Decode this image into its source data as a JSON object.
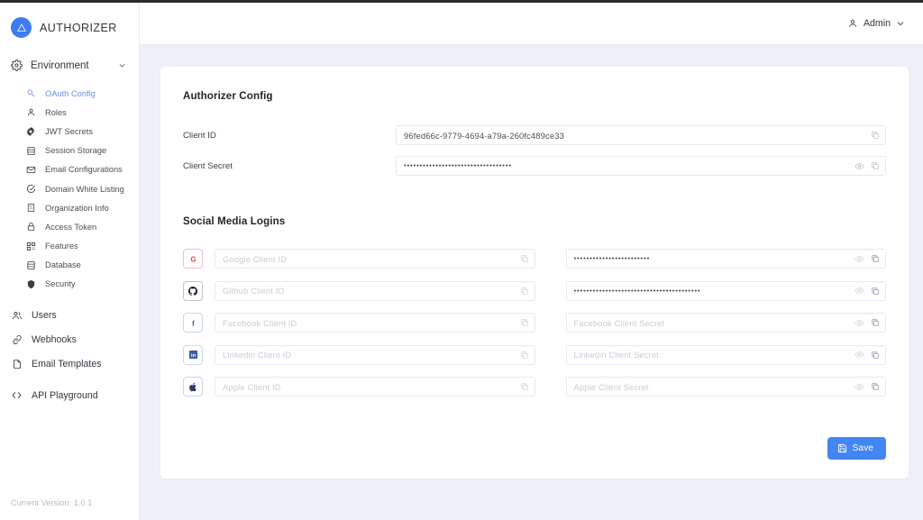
{
  "brand": {
    "name": "AUTHORIZER",
    "logo_icon": "triangle-logo-icon",
    "logo_color": "#3e7bf2"
  },
  "header": {
    "user_label": "Admin",
    "user_icon": "person-icon",
    "chevron_icon": "chevron-down-icon"
  },
  "sidebar": {
    "environment": {
      "label": "Environment",
      "icon": "gear-icon",
      "chevron": "chevron-down-icon"
    },
    "sub_items": [
      {
        "label": "OAuth Config",
        "icon": "key-icon",
        "active": true
      },
      {
        "label": "Roles",
        "icon": "person-icon",
        "active": false
      },
      {
        "label": "JWT Secrets",
        "icon": "cog-icon",
        "active": false
      },
      {
        "label": "Session Storage",
        "icon": "database-icon",
        "active": false
      },
      {
        "label": "Email Configurations",
        "icon": "mail-icon",
        "active": false
      },
      {
        "label": "Domain White Listing",
        "icon": "check-circle-icon",
        "active": false
      },
      {
        "label": "Organization Info",
        "icon": "building-icon",
        "active": false
      },
      {
        "label": "Access Token",
        "icon": "lock-icon",
        "active": false
      },
      {
        "label": "Features",
        "icon": "grid-icon",
        "active": false
      },
      {
        "label": "Database",
        "icon": "database-icon",
        "active": false
      },
      {
        "label": "Security",
        "icon": "shield-icon",
        "active": false
      }
    ],
    "main_items": [
      {
        "label": "Users",
        "icon": "users-icon"
      },
      {
        "label": "Webhooks",
        "icon": "link-icon"
      },
      {
        "label": "Email Templates",
        "icon": "document-icon"
      },
      {
        "label": "API Playground",
        "icon": "code-icon"
      }
    ],
    "version": "Current Version: 1.0.1"
  },
  "main": {
    "config_section": {
      "title": "Authorizer Config",
      "fields": [
        {
          "label": "Client ID",
          "value": "96fed66c-9779-4694-a79a-260fc489ce33",
          "masked": false,
          "has_eye": false,
          "has_copy": true
        },
        {
          "label": "Client Secret",
          "value": "••••••••••••••••••••••••••••••••••",
          "masked": true,
          "has_eye": true,
          "has_copy": true
        }
      ]
    },
    "social_section": {
      "title": "Social Media Logins",
      "providers": [
        {
          "name": "google",
          "icon": "google-icon",
          "icon_color": "#ea4335",
          "id_placeholder": "Google Client ID",
          "id_value": "",
          "secret_placeholder": "Google Client Secret",
          "secret_value": "••••••••••••••••••••••••"
        },
        {
          "name": "github",
          "icon": "github-icon",
          "icon_color": "#1b1f23",
          "id_placeholder": "Github Client ID",
          "id_value": "",
          "secret_placeholder": "Github Client Secret",
          "secret_value": "••••••••••••••••••••••••••••••••••••••••"
        },
        {
          "name": "facebook",
          "icon": "facebook-icon",
          "icon_color": "#3b5998",
          "id_placeholder": "Facebook Client ID",
          "id_value": "",
          "secret_placeholder": "Facebook Client Secret",
          "secret_value": ""
        },
        {
          "name": "linkedin",
          "icon": "linkedin-icon",
          "icon_color": "#3b5fa8",
          "id_placeholder": "Linkedin Client ID",
          "id_value": "",
          "secret_placeholder": "Linkedin Client Secret",
          "secret_value": ""
        },
        {
          "name": "apple",
          "icon": "apple-icon",
          "icon_color": "#2b3a67",
          "id_placeholder": "Apple Client ID",
          "id_value": "",
          "secret_placeholder": "Apple Client Secret",
          "secret_value": ""
        }
      ]
    },
    "save_button": {
      "label": "Save",
      "icon": "save-icon",
      "color": "#4285f4"
    }
  }
}
